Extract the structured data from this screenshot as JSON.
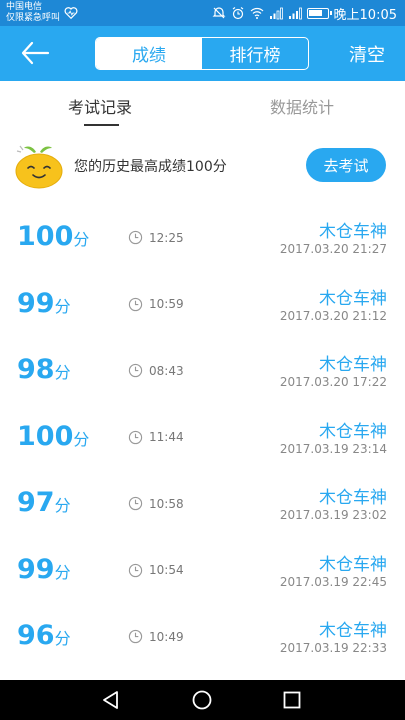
{
  "statusbar": {
    "carrier_line1": "中国电信",
    "carrier_line2": "仅限紧急呼叫",
    "time": "晚上10:05"
  },
  "header": {
    "tabs": [
      "成绩",
      "排行榜"
    ],
    "active_tab": "成绩",
    "clear_label": "清空"
  },
  "subtabs": [
    "考试记录",
    "数据统计"
  ],
  "best": {
    "text": "您的历史最高成绩100分",
    "button": "去考试"
  },
  "score_unit": "分",
  "records": [
    {
      "score": "100",
      "duration": "12:25",
      "name": "木仓车神",
      "date": "2017.03.20  21:27"
    },
    {
      "score": "99",
      "duration": "10:59",
      "name": "木仓车神",
      "date": "2017.03.20  21:12"
    },
    {
      "score": "98",
      "duration": "08:43",
      "name": "木仓车神",
      "date": "2017.03.20  17:22"
    },
    {
      "score": "100",
      "duration": "11:44",
      "name": "木仓车神",
      "date": "2017.03.19  23:14"
    },
    {
      "score": "97",
      "duration": "10:58",
      "name": "木仓车神",
      "date": "2017.03.19  23:02"
    },
    {
      "score": "99",
      "duration": "10:54",
      "name": "木仓车神",
      "date": "2017.03.19  22:45"
    },
    {
      "score": "96",
      "duration": "10:49",
      "name": "木仓车神",
      "date": "2017.03.19  22:33"
    }
  ],
  "colors": {
    "accent": "#29a8f0",
    "statusbar": "#1e88d6"
  }
}
